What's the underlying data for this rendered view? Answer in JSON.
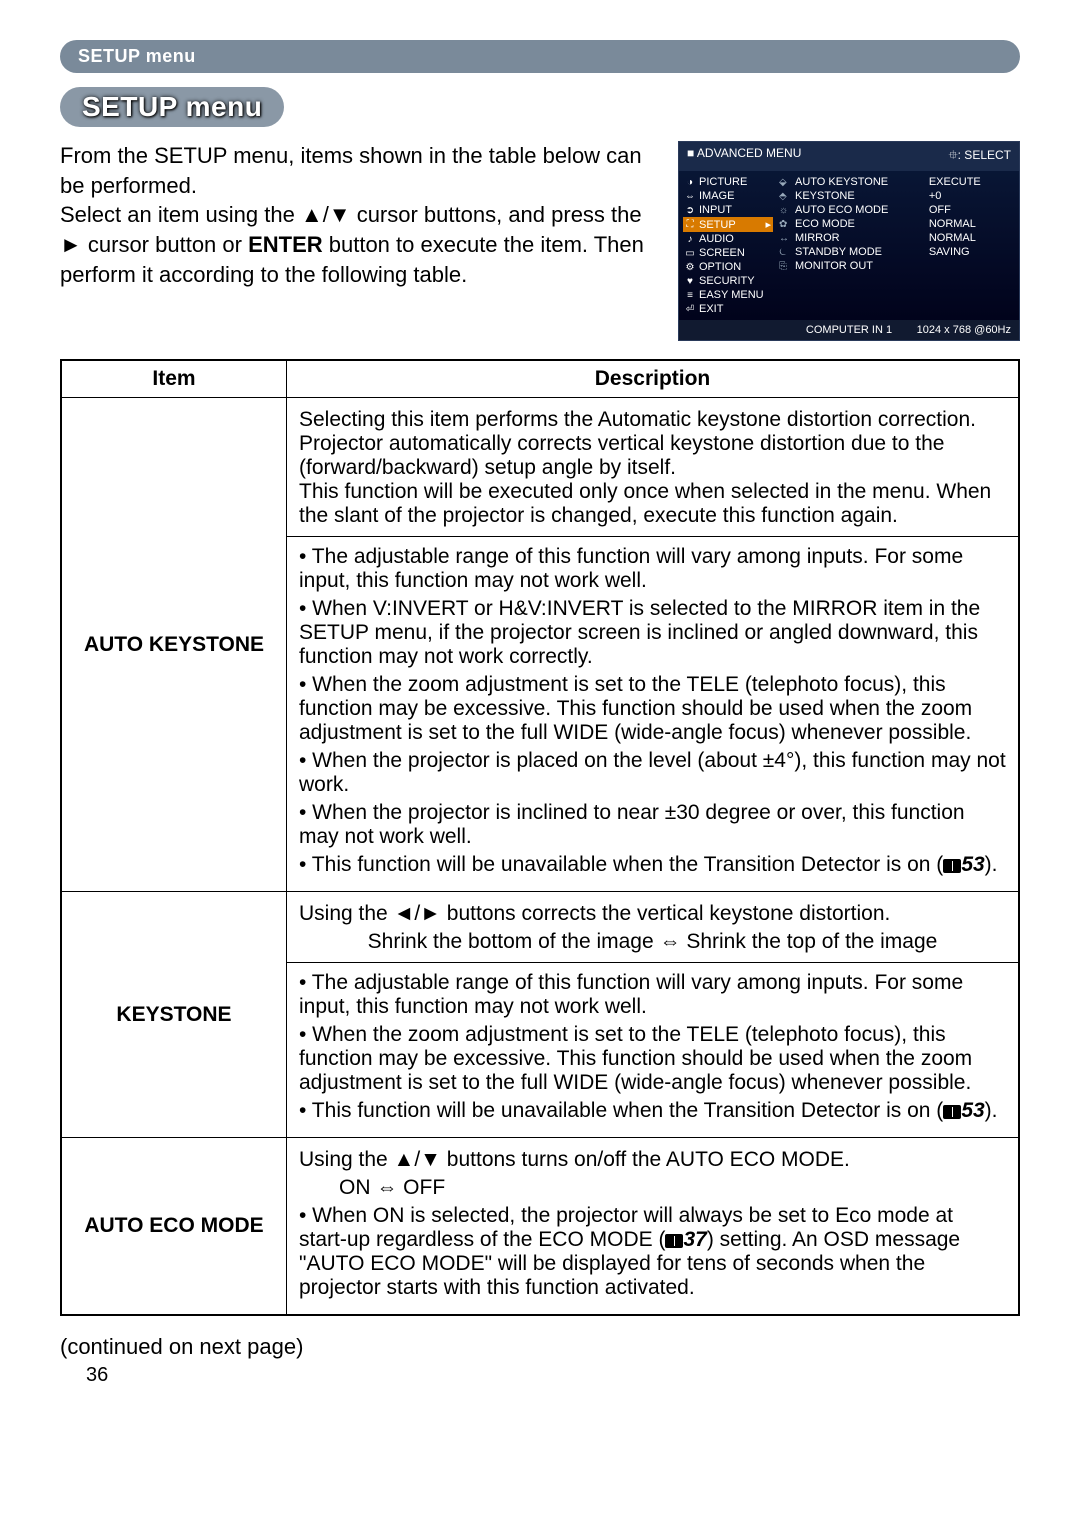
{
  "header_bar": "SETUP menu",
  "pill_title": "SETUP menu",
  "intro": "From the SETUP menu, items shown in the table below can be performed.\nSelect an item using the ▲/▼ cursor buttons, and press the ► cursor button or ENTER button to execute the item. Then perform it according to the following table.",
  "intro_enter": "ENTER",
  "osd": {
    "title_left": "ADVANCED MENU",
    "title_right_icon": "⯐",
    "title_right": ": SELECT",
    "left_menu": [
      {
        "icon": "◑",
        "label": "PICTURE"
      },
      {
        "icon": "⇔",
        "label": "IMAGE"
      },
      {
        "icon": "➲",
        "label": "INPUT"
      },
      {
        "icon": "⛶",
        "label": "SETUP",
        "selected": true
      },
      {
        "icon": "♪",
        "label": "AUDIO"
      },
      {
        "icon": "▭",
        "label": "SCREEN"
      },
      {
        "icon": "⚙",
        "label": "OPTION"
      },
      {
        "icon": "♥",
        "label": "SECURITY"
      },
      {
        "icon": "≡",
        "label": "EASY MENU"
      },
      {
        "icon": "⏎",
        "label": "EXIT"
      }
    ],
    "right_items": [
      {
        "icon": "⬙",
        "name": "AUTO KEYSTONE",
        "value": "EXECUTE"
      },
      {
        "icon": "⬘",
        "name": "KEYSTONE",
        "value": "+0"
      },
      {
        "icon": "☼",
        "name": "AUTO ECO MODE",
        "value": "OFF"
      },
      {
        "icon": "✿",
        "name": "ECO MODE",
        "value": "NORMAL"
      },
      {
        "icon": "↔",
        "name": "MIRROR",
        "value": "NORMAL"
      },
      {
        "icon": "⏾",
        "name": "STANDBY MODE",
        "value": "SAVING"
      },
      {
        "icon": "⎘",
        "name": "MONITOR OUT",
        "value": ""
      }
    ],
    "footer_mid": "COMPUTER IN 1",
    "footer_right": "1024 x 768 @60Hz"
  },
  "table": {
    "col_item": "Item",
    "col_desc": "Description",
    "rows": [
      {
        "item": "AUTO KEYSTONE",
        "top": "Selecting this item performs the Automatic keystone distortion correction. Projector automatically corrects vertical keystone distortion due to the (forward/backward) setup angle by itself.\nThis function will be executed only once when selected in the menu. When the slant of the projector is changed, execute this function again.",
        "bottom_lines": [
          "• The adjustable range of this function will vary among inputs. For some input, this function may not work well.",
          "• When V:INVERT or H&V:INVERT is selected to the MIRROR item in the SETUP menu, if the projector screen is inclined or angled downward, this function may not work correctly.",
          "• When the zoom adjustment is set to the TELE (telephoto focus), this function may be excessive. This function should be used when the zoom adjustment is set to the full WIDE (wide-angle focus) whenever possible.",
          "• When the projector is placed on the level (about ±4°), this function may not work.",
          "• When the projector is inclined to near ±30 degree or over, this function may not work well.",
          "• This function will be unavailable when the Transition Detector is on ("
        ],
        "ref": "53",
        "ref_tail": ")."
      },
      {
        "item": "KEYSTONE",
        "line1": "Using the ◄/► buttons corrects the vertical keystone distortion.",
        "center_line": "Shrink the bottom of the image ⇔ Shrink the top of the image",
        "bottom_lines": [
          "• The adjustable range of this function will vary among inputs. For some input, this function may not work well.",
          "• When the zoom adjustment is set to the TELE (telephoto focus), this function may be excessive. This function should be used when the zoom adjustment is set to the full WIDE (wide-angle focus) whenever possible.",
          "• This function will be unavailable when the Transition Detector is on ("
        ],
        "ref": "53",
        "ref_tail": ")."
      },
      {
        "item": "AUTO ECO MODE",
        "line1": "Using the ▲/▼ buttons turns on/off the AUTO ECO MODE.",
        "center_line": "ON ⇔ OFF",
        "rest_pre": "• When ON is selected, the projector will always be set to Eco mode at start-up regardless of the ECO MODE (",
        "ref": "37",
        "rest_post": ") setting. An OSD message \"AUTO ECO MODE\" will be displayed for tens of seconds when the projector starts with this function activated."
      }
    ]
  },
  "continued": "(continued on next page)",
  "page_number": "36"
}
